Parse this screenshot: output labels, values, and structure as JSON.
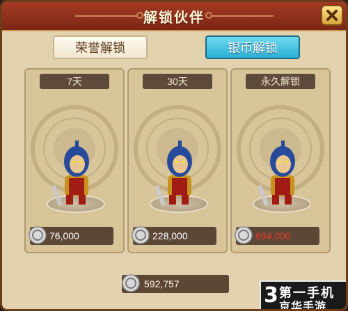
{
  "dialog": {
    "title": "解锁伙伴",
    "close_icon": "close-x-icon"
  },
  "tabs": [
    {
      "label": "荣誉解锁",
      "active": false
    },
    {
      "label": "银币解锁",
      "active": true
    }
  ],
  "options": [
    {
      "duration": "7天",
      "price": "76,000",
      "affordable": true
    },
    {
      "duration": "30天",
      "price": "228,000",
      "affordable": true
    },
    {
      "duration": "永久解锁",
      "price": "684,000",
      "affordable": false
    }
  ],
  "balance": {
    "amount": "592,757"
  },
  "icons": {
    "coin": "silver-coin-icon",
    "hero": "hero-warrior-icon"
  },
  "colors": {
    "title_bar": "#8b2c1a",
    "active_tab": "#2bb0d4",
    "insufficient_price": "#e53b2a"
  },
  "watermark": {
    "line1": "第一手机",
    "line2": "京华手游",
    "glyph": "3"
  }
}
